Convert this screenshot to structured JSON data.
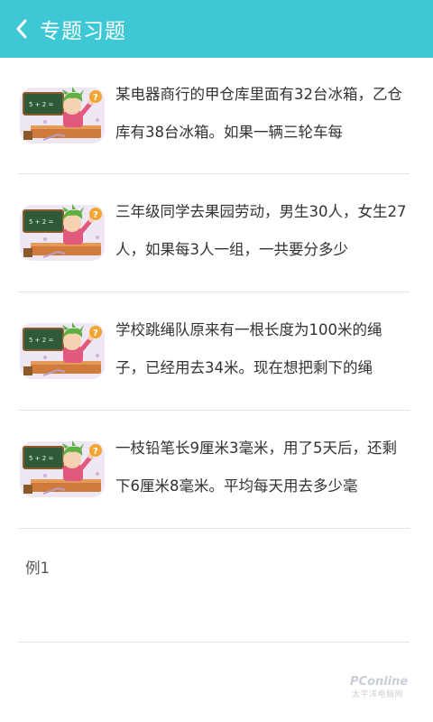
{
  "header": {
    "back_icon": "chevron-left-icon",
    "title": "专题习题",
    "bg_color": "#3ec8d6"
  },
  "items": [
    {
      "thumb_icon": "teacher-blackboard-illustration",
      "text": "某电器商行的甲仓库里面有32台冰箱，乙仓库有38台冰箱。如果一辆三轮车每"
    },
    {
      "thumb_icon": "teacher-blackboard-illustration",
      "text": "三年级同学去果园劳动，男生30人，女生27人，如果每3人一组，一共要分多少"
    },
    {
      "thumb_icon": "teacher-blackboard-illustration",
      "text": "学校跳绳队原来有一根长度为100米的绳子，已经用去34米。现在想把剩下的绳"
    },
    {
      "thumb_icon": "teacher-blackboard-illustration",
      "text": "一枝铅笔长9厘米3毫米，用了5天后，还剩下6厘米8毫米。平均每天用去多少毫"
    }
  ],
  "extra_item": {
    "label": "例1"
  },
  "watermark": {
    "brand": "PConline",
    "sub": "太平洋电脑网"
  }
}
